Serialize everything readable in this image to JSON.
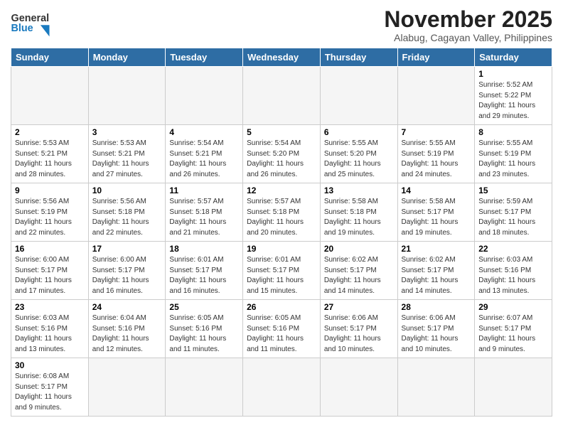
{
  "header": {
    "logo_text_black": "General",
    "logo_text_blue": "Blue",
    "month_title": "November 2025",
    "location": "Alabug, Cagayan Valley, Philippines"
  },
  "weekdays": [
    "Sunday",
    "Monday",
    "Tuesday",
    "Wednesday",
    "Thursday",
    "Friday",
    "Saturday"
  ],
  "weeks": [
    [
      {
        "day": "",
        "empty": true
      },
      {
        "day": "",
        "empty": true
      },
      {
        "day": "",
        "empty": true
      },
      {
        "day": "",
        "empty": true
      },
      {
        "day": "",
        "empty": true
      },
      {
        "day": "",
        "empty": true
      },
      {
        "day": "1",
        "sunrise": "Sunrise: 5:52 AM",
        "sunset": "Sunset: 5:22 PM",
        "daylight": "Daylight: 11 hours and 29 minutes."
      }
    ],
    [
      {
        "day": "2",
        "sunrise": "Sunrise: 5:53 AM",
        "sunset": "Sunset: 5:21 PM",
        "daylight": "Daylight: 11 hours and 28 minutes."
      },
      {
        "day": "3",
        "sunrise": "Sunrise: 5:53 AM",
        "sunset": "Sunset: 5:21 PM",
        "daylight": "Daylight: 11 hours and 27 minutes."
      },
      {
        "day": "4",
        "sunrise": "Sunrise: 5:54 AM",
        "sunset": "Sunset: 5:21 PM",
        "daylight": "Daylight: 11 hours and 26 minutes."
      },
      {
        "day": "5",
        "sunrise": "Sunrise: 5:54 AM",
        "sunset": "Sunset: 5:20 PM",
        "daylight": "Daylight: 11 hours and 26 minutes."
      },
      {
        "day": "6",
        "sunrise": "Sunrise: 5:55 AM",
        "sunset": "Sunset: 5:20 PM",
        "daylight": "Daylight: 11 hours and 25 minutes."
      },
      {
        "day": "7",
        "sunrise": "Sunrise: 5:55 AM",
        "sunset": "Sunset: 5:19 PM",
        "daylight": "Daylight: 11 hours and 24 minutes."
      },
      {
        "day": "8",
        "sunrise": "Sunrise: 5:55 AM",
        "sunset": "Sunset: 5:19 PM",
        "daylight": "Daylight: 11 hours and 23 minutes."
      }
    ],
    [
      {
        "day": "9",
        "sunrise": "Sunrise: 5:56 AM",
        "sunset": "Sunset: 5:19 PM",
        "daylight": "Daylight: 11 hours and 22 minutes."
      },
      {
        "day": "10",
        "sunrise": "Sunrise: 5:56 AM",
        "sunset": "Sunset: 5:18 PM",
        "daylight": "Daylight: 11 hours and 22 minutes."
      },
      {
        "day": "11",
        "sunrise": "Sunrise: 5:57 AM",
        "sunset": "Sunset: 5:18 PM",
        "daylight": "Daylight: 11 hours and 21 minutes."
      },
      {
        "day": "12",
        "sunrise": "Sunrise: 5:57 AM",
        "sunset": "Sunset: 5:18 PM",
        "daylight": "Daylight: 11 hours and 20 minutes."
      },
      {
        "day": "13",
        "sunrise": "Sunrise: 5:58 AM",
        "sunset": "Sunset: 5:18 PM",
        "daylight": "Daylight: 11 hours and 19 minutes."
      },
      {
        "day": "14",
        "sunrise": "Sunrise: 5:58 AM",
        "sunset": "Sunset: 5:17 PM",
        "daylight": "Daylight: 11 hours and 19 minutes."
      },
      {
        "day": "15",
        "sunrise": "Sunrise: 5:59 AM",
        "sunset": "Sunset: 5:17 PM",
        "daylight": "Daylight: 11 hours and 18 minutes."
      }
    ],
    [
      {
        "day": "16",
        "sunrise": "Sunrise: 6:00 AM",
        "sunset": "Sunset: 5:17 PM",
        "daylight": "Daylight: 11 hours and 17 minutes."
      },
      {
        "day": "17",
        "sunrise": "Sunrise: 6:00 AM",
        "sunset": "Sunset: 5:17 PM",
        "daylight": "Daylight: 11 hours and 16 minutes."
      },
      {
        "day": "18",
        "sunrise": "Sunrise: 6:01 AM",
        "sunset": "Sunset: 5:17 PM",
        "daylight": "Daylight: 11 hours and 16 minutes."
      },
      {
        "day": "19",
        "sunrise": "Sunrise: 6:01 AM",
        "sunset": "Sunset: 5:17 PM",
        "daylight": "Daylight: 11 hours and 15 minutes."
      },
      {
        "day": "20",
        "sunrise": "Sunrise: 6:02 AM",
        "sunset": "Sunset: 5:17 PM",
        "daylight": "Daylight: 11 hours and 14 minutes."
      },
      {
        "day": "21",
        "sunrise": "Sunrise: 6:02 AM",
        "sunset": "Sunset: 5:17 PM",
        "daylight": "Daylight: 11 hours and 14 minutes."
      },
      {
        "day": "22",
        "sunrise": "Sunrise: 6:03 AM",
        "sunset": "Sunset: 5:16 PM",
        "daylight": "Daylight: 11 hours and 13 minutes."
      }
    ],
    [
      {
        "day": "23",
        "sunrise": "Sunrise: 6:03 AM",
        "sunset": "Sunset: 5:16 PM",
        "daylight": "Daylight: 11 hours and 13 minutes."
      },
      {
        "day": "24",
        "sunrise": "Sunrise: 6:04 AM",
        "sunset": "Sunset: 5:16 PM",
        "daylight": "Daylight: 11 hours and 12 minutes."
      },
      {
        "day": "25",
        "sunrise": "Sunrise: 6:05 AM",
        "sunset": "Sunset: 5:16 PM",
        "daylight": "Daylight: 11 hours and 11 minutes."
      },
      {
        "day": "26",
        "sunrise": "Sunrise: 6:05 AM",
        "sunset": "Sunset: 5:16 PM",
        "daylight": "Daylight: 11 hours and 11 minutes."
      },
      {
        "day": "27",
        "sunrise": "Sunrise: 6:06 AM",
        "sunset": "Sunset: 5:17 PM",
        "daylight": "Daylight: 11 hours and 10 minutes."
      },
      {
        "day": "28",
        "sunrise": "Sunrise: 6:06 AM",
        "sunset": "Sunset: 5:17 PM",
        "daylight": "Daylight: 11 hours and 10 minutes."
      },
      {
        "day": "29",
        "sunrise": "Sunrise: 6:07 AM",
        "sunset": "Sunset: 5:17 PM",
        "daylight": "Daylight: 11 hours and 9 minutes."
      }
    ],
    [
      {
        "day": "30",
        "sunrise": "Sunrise: 6:08 AM",
        "sunset": "Sunset: 5:17 PM",
        "daylight": "Daylight: 11 hours and 9 minutes."
      },
      {
        "day": "",
        "empty": true
      },
      {
        "day": "",
        "empty": true
      },
      {
        "day": "",
        "empty": true
      },
      {
        "day": "",
        "empty": true
      },
      {
        "day": "",
        "empty": true
      },
      {
        "day": "",
        "empty": true
      }
    ]
  ]
}
